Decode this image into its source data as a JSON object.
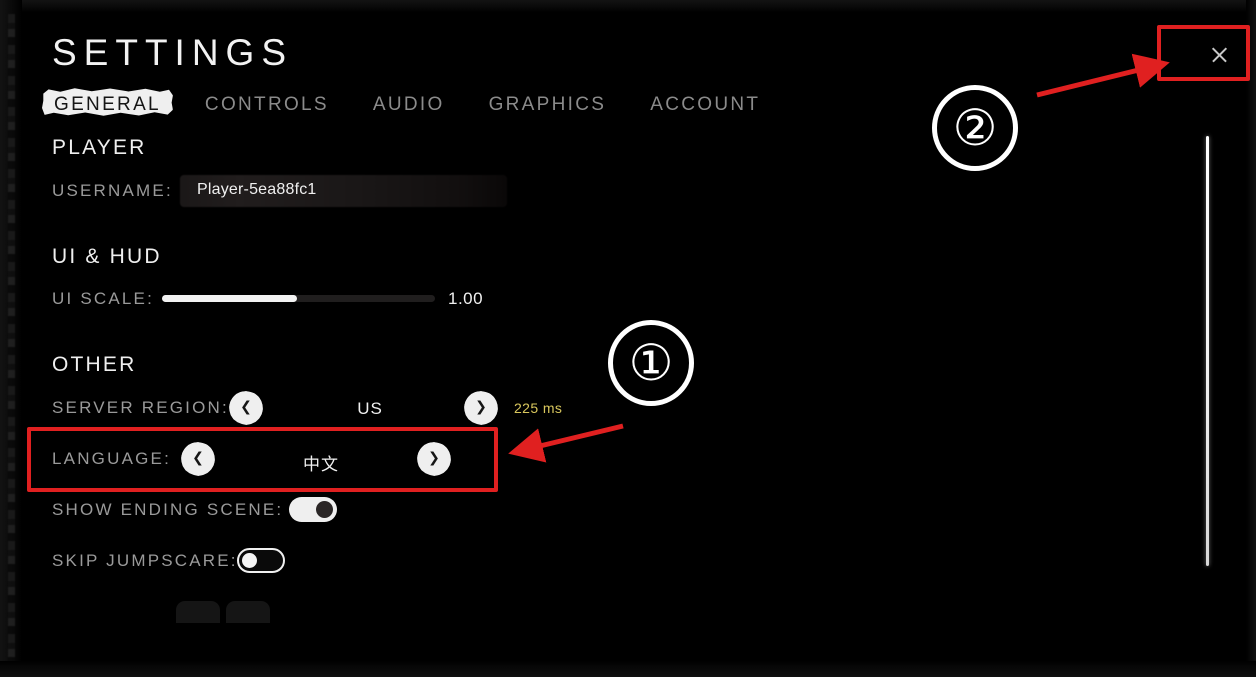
{
  "window": {
    "title": "SETTINGS",
    "close_icon": "close-icon"
  },
  "tabs": [
    {
      "label": "GENERAL",
      "active": true
    },
    {
      "label": "CONTROLS",
      "active": false
    },
    {
      "label": "AUDIO",
      "active": false
    },
    {
      "label": "GRAPHICS",
      "active": false
    },
    {
      "label": "ACCOUNT",
      "active": false
    }
  ],
  "sections": {
    "player": {
      "heading": "PLAYER",
      "username": {
        "label": "USERNAME:",
        "value": "Player-5ea88fc1"
      }
    },
    "ui_hud": {
      "heading": "UI & HUD",
      "ui_scale": {
        "label": "UI SCALE:",
        "value": "1.00",
        "fill_percent": 49
      }
    },
    "other": {
      "heading": "OTHER",
      "server_region": {
        "label": "SERVER REGION:",
        "value": "US",
        "ping": "225 ms",
        "prev_icon": "chevron-left-icon",
        "next_icon": "chevron-right-icon"
      },
      "language": {
        "label": "LANGUAGE:",
        "value": "中文",
        "prev_icon": "chevron-left-icon",
        "next_icon": "chevron-right-icon"
      },
      "show_ending_scene": {
        "label": "SHOW ENDING SCENE:",
        "state": "on"
      },
      "skip_jumpscare": {
        "label": "SKIP JUMPSCARE:",
        "state": "off"
      }
    }
  },
  "annotations": {
    "step_one": "①",
    "step_two": "②"
  },
  "colors": {
    "accent_red": "#e02020",
    "ping_yellow": "#d9c75d",
    "panel_background": "#000000",
    "text_primary": "#f0f0f0",
    "text_muted": "#9a9a9a"
  }
}
